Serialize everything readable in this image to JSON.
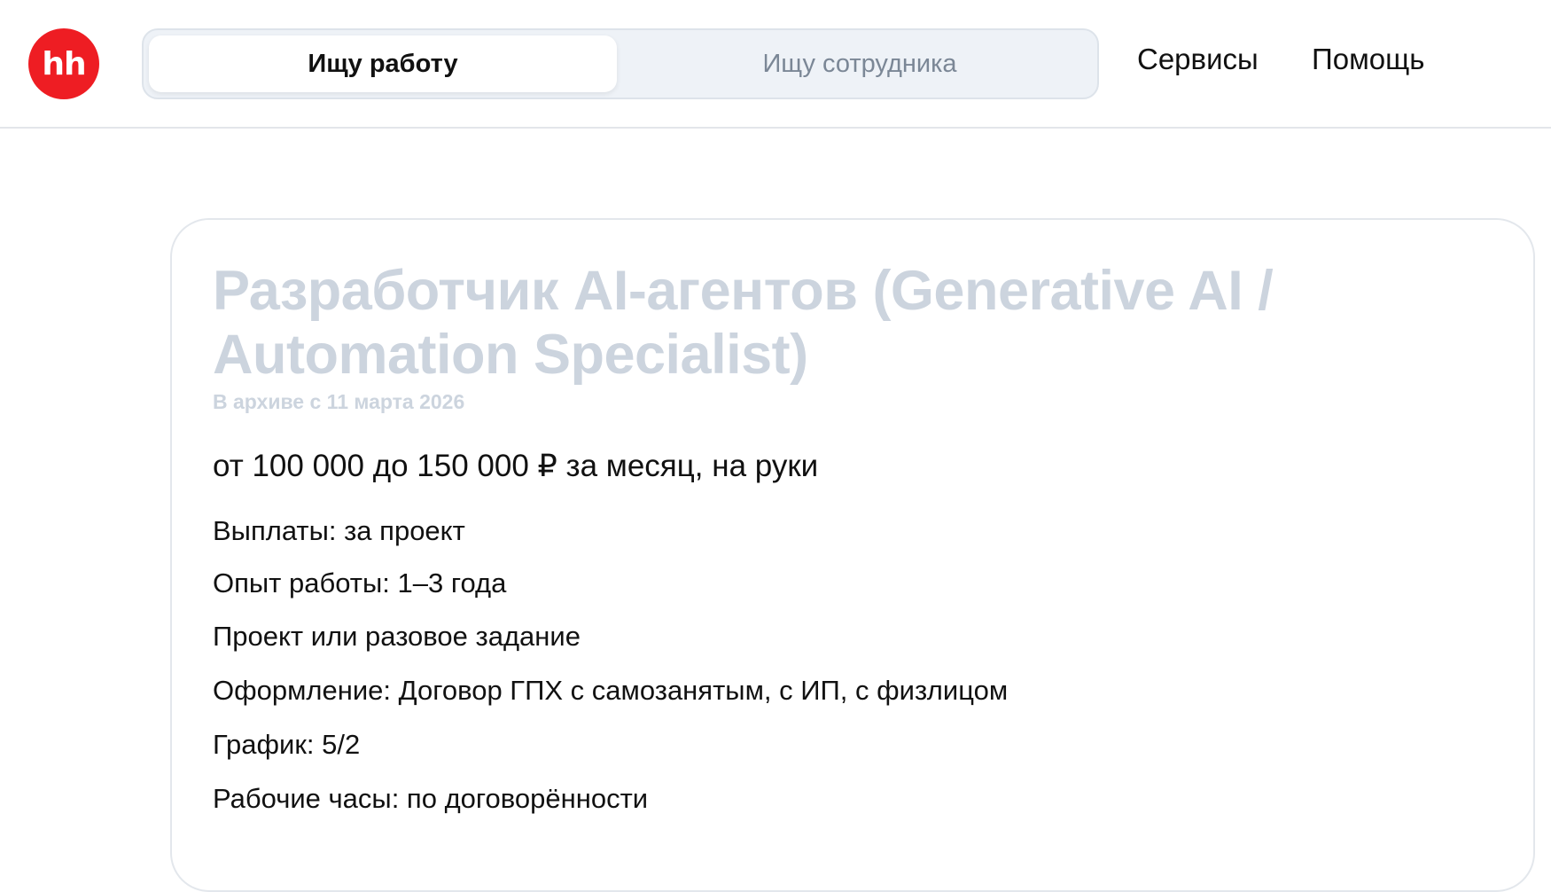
{
  "header": {
    "logo_text": "hh",
    "tabs": [
      {
        "label": "Ищу работу",
        "active": true
      },
      {
        "label": "Ищу сотрудника",
        "active": false
      }
    ],
    "nav": [
      {
        "label": "Сервисы"
      },
      {
        "label": "Помощь"
      }
    ]
  },
  "vacancy": {
    "title": "Разработчик AI-агентов (Generative AI / Automation Specialist)",
    "archived_label": "В архиве с 11 марта 2026",
    "salary": "от 100 000 до 150 000 ₽ за месяц, на руки",
    "details": [
      "Выплаты: за проект",
      "Опыт работы: 1–3 года",
      "Проект или разовое задание",
      "Оформление: Договор ГПХ с самозанятым, с ИП, с физлицом",
      "График: 5/2",
      "Рабочие часы: по договорённости"
    ]
  },
  "colors": {
    "brand_red": "#ee1d23",
    "archived_title_gray": "#ccd4de",
    "switcher_bg": "#eef2f7"
  }
}
